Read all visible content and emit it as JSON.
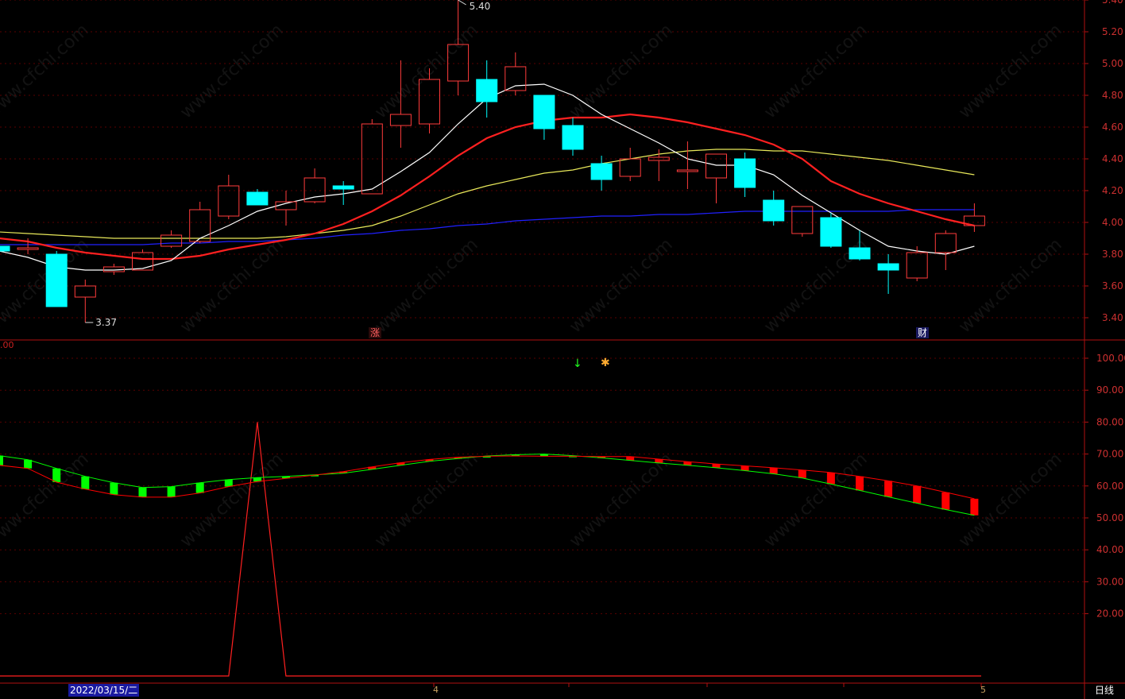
{
  "period_label": "日线",
  "cursor_date": "2022/03/15/二",
  "month_ticks": [
    "4",
    "5"
  ],
  "subpanel_top_value": ".00",
  "watermark": "www.cfchi.com",
  "markers": {
    "zhang": "涨",
    "cai": "财"
  },
  "colors": {
    "up": "#ff3b3b",
    "down": "#00ffff",
    "ma5": "#ffffff",
    "ma10": "#ff2020",
    "ma20": "#e8e85a",
    "ma60": "#2020ff",
    "axis": "#b01010",
    "grid": "#5a0000",
    "osc_up": "#ff0000",
    "osc_down": "#00ff00",
    "spike": "#ff2020"
  },
  "chart_data": [
    {
      "type": "candlestick",
      "ylim": [
        3.3,
        5.44
      ],
      "yticks": [
        "3.40",
        "3.60",
        "3.80",
        "4.00",
        "4.20",
        "4.40",
        "4.60",
        "4.80",
        "5.00",
        "5.20",
        "5.40"
      ],
      "annotations": {
        "high": "5.40",
        "low": "3.37"
      },
      "candles": [
        {
          "o": 3.85,
          "h": 3.9,
          "l": 3.75,
          "c": 3.82
        },
        {
          "o": 3.83,
          "h": 3.9,
          "l": 3.8,
          "c": 3.84
        },
        {
          "o": 3.8,
          "h": 3.82,
          "l": 3.47,
          "c": 3.47
        },
        {
          "o": 3.53,
          "h": 3.64,
          "l": 3.37,
          "c": 3.6
        },
        {
          "o": 3.69,
          "h": 3.74,
          "l": 3.67,
          "c": 3.72
        },
        {
          "o": 3.7,
          "h": 3.83,
          "l": 3.7,
          "c": 3.81
        },
        {
          "o": 3.85,
          "h": 3.95,
          "l": 3.84,
          "c": 3.92
        },
        {
          "o": 3.88,
          "h": 4.13,
          "l": 3.87,
          "c": 4.08
        },
        {
          "o": 4.04,
          "h": 4.3,
          "l": 4.02,
          "c": 4.23
        },
        {
          "o": 4.19,
          "h": 4.21,
          "l": 4.11,
          "c": 4.11
        },
        {
          "o": 4.08,
          "h": 4.2,
          "l": 3.98,
          "c": 4.13
        },
        {
          "o": 4.13,
          "h": 4.34,
          "l": 4.12,
          "c": 4.28
        },
        {
          "o": 4.23,
          "h": 4.26,
          "l": 4.11,
          "c": 4.21
        },
        {
          "o": 4.18,
          "h": 4.65,
          "l": 4.18,
          "c": 4.62
        },
        {
          "o": 4.61,
          "h": 5.02,
          "l": 4.47,
          "c": 4.68
        },
        {
          "o": 4.62,
          "h": 4.97,
          "l": 4.56,
          "c": 4.9
        },
        {
          "o": 4.89,
          "h": 5.4,
          "l": 4.8,
          "c": 5.12
        },
        {
          "o": 4.9,
          "h": 5.02,
          "l": 4.66,
          "c": 4.76
        },
        {
          "o": 4.83,
          "h": 5.07,
          "l": 4.8,
          "c": 4.98
        },
        {
          "o": 4.8,
          "h": 4.8,
          "l": 4.52,
          "c": 4.59
        },
        {
          "o": 4.61,
          "h": 4.66,
          "l": 4.42,
          "c": 4.46
        },
        {
          "o": 4.37,
          "h": 4.42,
          "l": 4.2,
          "c": 4.27
        },
        {
          "o": 4.29,
          "h": 4.47,
          "l": 4.26,
          "c": 4.4
        },
        {
          "o": 4.39,
          "h": 4.46,
          "l": 4.26,
          "c": 4.41
        },
        {
          "o": 4.32,
          "h": 4.51,
          "l": 4.21,
          "c": 4.33
        },
        {
          "o": 4.28,
          "h": 4.43,
          "l": 4.12,
          "c": 4.43
        },
        {
          "o": 4.4,
          "h": 4.44,
          "l": 4.16,
          "c": 4.22
        },
        {
          "o": 4.14,
          "h": 4.2,
          "l": 3.98,
          "c": 4.01
        },
        {
          "o": 3.93,
          "h": 4.1,
          "l": 3.91,
          "c": 4.1
        },
        {
          "o": 4.03,
          "h": 4.06,
          "l": 3.84,
          "c": 3.85
        },
        {
          "o": 3.84,
          "h": 3.95,
          "l": 3.76,
          "c": 3.77
        },
        {
          "o": 3.74,
          "h": 3.8,
          "l": 3.55,
          "c": 3.7
        },
        {
          "o": 3.65,
          "h": 3.85,
          "l": 3.63,
          "c": 3.81
        },
        {
          "o": 3.81,
          "h": 3.95,
          "l": 3.7,
          "c": 3.93
        },
        {
          "o": 3.98,
          "h": 4.12,
          "l": 3.94,
          "c": 4.04
        }
      ],
      "ma5": [
        3.82,
        3.78,
        3.72,
        3.7,
        3.7,
        3.71,
        3.76,
        3.9,
        3.98,
        4.07,
        4.12,
        4.16,
        4.18,
        4.21,
        4.32,
        4.44,
        4.62,
        4.78,
        4.86,
        4.87,
        4.8,
        4.68,
        4.59,
        4.5,
        4.4,
        4.36,
        4.36,
        4.3,
        4.17,
        4.06,
        3.95,
        3.85,
        3.82,
        3.8,
        3.85
      ],
      "ma10": [
        3.9,
        3.88,
        3.84,
        3.81,
        3.79,
        3.77,
        3.77,
        3.79,
        3.83,
        3.86,
        3.89,
        3.93,
        3.99,
        4.07,
        4.17,
        4.29,
        4.42,
        4.53,
        4.6,
        4.64,
        4.66,
        4.66,
        4.68,
        4.66,
        4.63,
        4.59,
        4.55,
        4.49,
        4.4,
        4.26,
        4.18,
        4.12,
        4.07,
        4.02,
        3.98
      ],
      "ma20": [
        3.94,
        3.93,
        3.92,
        3.91,
        3.9,
        3.9,
        3.9,
        3.9,
        3.9,
        3.9,
        3.91,
        3.93,
        3.95,
        3.98,
        4.04,
        4.11,
        4.18,
        4.23,
        4.27,
        4.31,
        4.33,
        4.37,
        4.4,
        4.43,
        4.45,
        4.46,
        4.46,
        4.45,
        4.45,
        4.43,
        4.41,
        4.39,
        4.36,
        4.33,
        4.3
      ],
      "ma60": [
        3.86,
        3.86,
        3.86,
        3.86,
        3.86,
        3.86,
        3.87,
        3.87,
        3.88,
        3.88,
        3.89,
        3.9,
        3.92,
        3.93,
        3.95,
        3.96,
        3.98,
        3.99,
        4.01,
        4.02,
        4.03,
        4.04,
        4.04,
        4.05,
        4.05,
        4.06,
        4.07,
        4.07,
        4.07,
        4.07,
        4.07,
        4.07,
        4.08,
        4.08,
        4.08
      ]
    },
    {
      "type": "oscillator",
      "ylim": [
        0,
        105
      ],
      "yticks": [
        "20.00",
        "30.00",
        "40.00",
        "50.00",
        "60.00",
        "70.00",
        "80.00",
        "90.00",
        "100.00"
      ],
      "line_a": [
        69.5,
        68.2,
        65.5,
        63.0,
        61.0,
        59.5,
        59.8,
        61.0,
        62.0,
        62.6,
        63.0,
        63.5,
        64.0,
        65.2,
        66.5,
        67.7,
        68.6,
        69.4,
        69.8,
        70.0,
        69.5,
        68.8,
        68.0,
        67.2,
        66.5,
        65.7,
        64.8,
        63.8,
        62.5,
        60.6,
        58.6,
        56.6,
        54.6,
        52.6,
        50.8
      ],
      "line_b": [
        66.5,
        65.5,
        61.2,
        59.0,
        57.3,
        56.5,
        56.5,
        57.8,
        59.8,
        61.4,
        62.4,
        63.4,
        64.5,
        66.0,
        67.3,
        68.3,
        69.0,
        69.3,
        69.4,
        69.3,
        69.3,
        69.2,
        69.2,
        68.4,
        67.6,
        66.9,
        66.3,
        65.7,
        65.0,
        64.2,
        63.0,
        61.6,
        60.0,
        58.0,
        56.0
      ],
      "spike": {
        "peak": 80.0,
        "base": 0.5,
        "index": 9
      }
    }
  ]
}
